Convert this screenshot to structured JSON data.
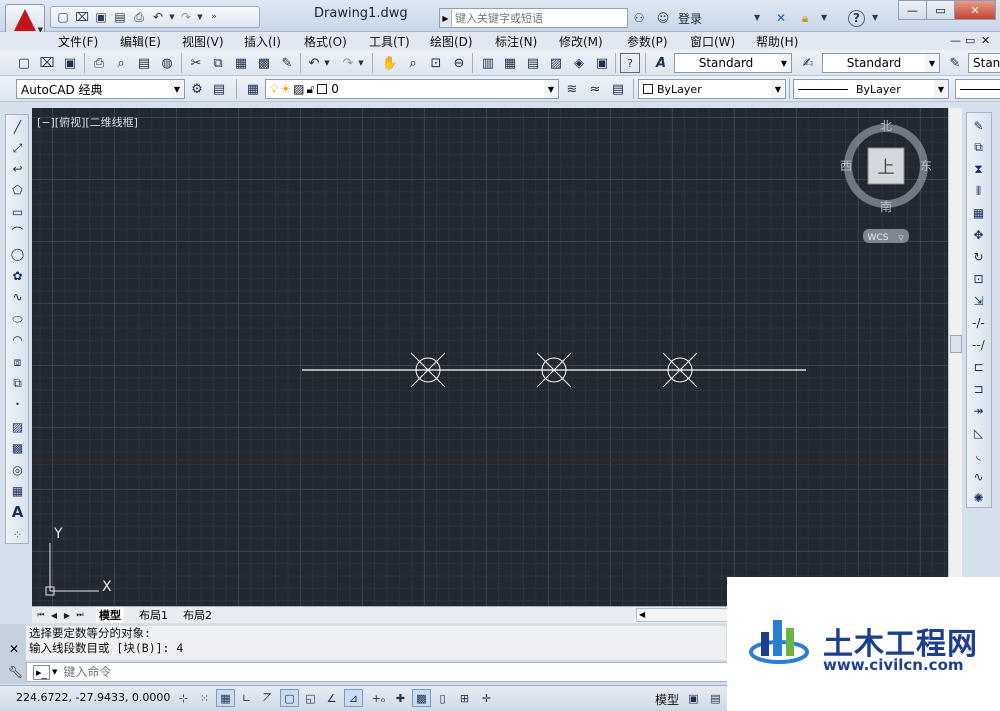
{
  "window": {
    "doc_title": "Drawing1.dwg",
    "search_placeholder": "键入关键字或短语",
    "login_label": "登录",
    "minimize_glyph": "—",
    "restore_glyph": "▭",
    "close_glyph": "✕"
  },
  "menubar": {
    "items": [
      "文件(F)",
      "编辑(E)",
      "视图(V)",
      "插入(I)",
      "格式(O)",
      "工具(T)",
      "绘图(D)",
      "标注(N)",
      "修改(M)",
      "参数(P)",
      "窗口(W)",
      "帮助(H)"
    ],
    "mdi_controls": [
      "—",
      "▭",
      "✕"
    ]
  },
  "toolbar1": {
    "text_style": "Standard",
    "dim_style": "Standard",
    "table_style_partial": "Stan"
  },
  "toolbar2": {
    "workspace": "AutoCAD 经典",
    "layer": "0",
    "color": "ByLayer",
    "linetype": "ByLayer"
  },
  "viewport": {
    "label": "[−][俯视][二维线框]",
    "viewcube": {
      "north": "北",
      "south": "南",
      "east": "东",
      "west": "西",
      "face": "上",
      "wcs": "WCS"
    },
    "ucs": {
      "x": "X",
      "y": "Y"
    },
    "divided_points": 3,
    "colors": {
      "background": "#212830",
      "line": "#ffffff",
      "axis_red": "#6b1a1a"
    }
  },
  "tabs": {
    "items": [
      "模型",
      "布局1",
      "布局2"
    ],
    "active": "模型"
  },
  "command": {
    "history": [
      "选择要定数等分的对象:",
      "输入线段数目或 [块(B)]: 4"
    ],
    "placeholder": "键入命令"
  },
  "status": {
    "coords": "224.6722, -27.9433, 0.0000",
    "space_label": "模型"
  },
  "watermark": {
    "title": "土木工程网",
    "url": "www.civilcn.com"
  }
}
